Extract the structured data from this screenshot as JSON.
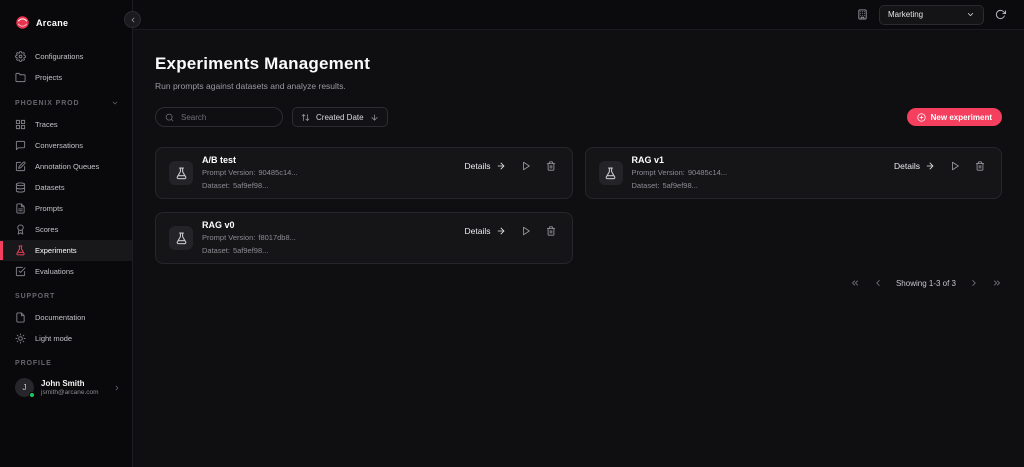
{
  "app": {
    "name": "Arcane",
    "accent": "#f43f5e",
    "status_green": "#22c55e"
  },
  "topbar": {
    "workspace": {
      "value": "Marketing",
      "icon": "building-icon"
    },
    "refresh_icon": "refresh-icon"
  },
  "sidebar": {
    "collapse_icon": "chevron-left-icon",
    "sections": [
      {
        "header": "",
        "items": [
          {
            "label": "Configurations",
            "icon": "gear-icon"
          },
          {
            "label": "Projects",
            "icon": "folder-icon"
          }
        ]
      },
      {
        "header": "PHOENIX PROD",
        "collapsible": true,
        "items": [
          {
            "label": "Traces",
            "icon": "grid-icon"
          },
          {
            "label": "Conversations",
            "icon": "chat-icon"
          },
          {
            "label": "Annotation Queues",
            "icon": "clipboard-pen-icon"
          },
          {
            "label": "Datasets",
            "icon": "database-icon"
          },
          {
            "label": "Prompts",
            "icon": "file-text-icon"
          },
          {
            "label": "Scores",
            "icon": "award-icon"
          },
          {
            "label": "Experiments",
            "icon": "flask-icon",
            "active": true
          },
          {
            "label": "Evaluations",
            "icon": "check-square-icon"
          }
        ]
      },
      {
        "header": "SUPPORT",
        "items": [
          {
            "label": "Documentation",
            "icon": "document-icon"
          },
          {
            "label": "Light mode",
            "icon": "sun-icon"
          }
        ]
      }
    ],
    "profile": {
      "header": "PROFILE",
      "initial": "J",
      "name": "John Smith",
      "email": "jsmith@arcane.com"
    }
  },
  "main": {
    "title": "Experiments Management",
    "subtitle": "Run prompts against datasets and analyze results.",
    "search": {
      "placeholder": "Search"
    },
    "sort": {
      "label": "Created Date"
    },
    "new_experiment_label": "New experiment",
    "field_labels": {
      "prompt_version": "Prompt Version:",
      "dataset": "Dataset:"
    },
    "details_label": "Details",
    "experiments": [
      {
        "name": "A/B test",
        "prompt_version": "90485c14...",
        "dataset": "5af9ef98..."
      },
      {
        "name": "RAG v1",
        "prompt_version": "90485c14...",
        "dataset": "5af9ef98..."
      },
      {
        "name": "RAG v0",
        "prompt_version": "f8017db8...",
        "dataset": "5af9ef98..."
      }
    ],
    "pagination": {
      "label": "Showing 1-3 of 3"
    }
  }
}
